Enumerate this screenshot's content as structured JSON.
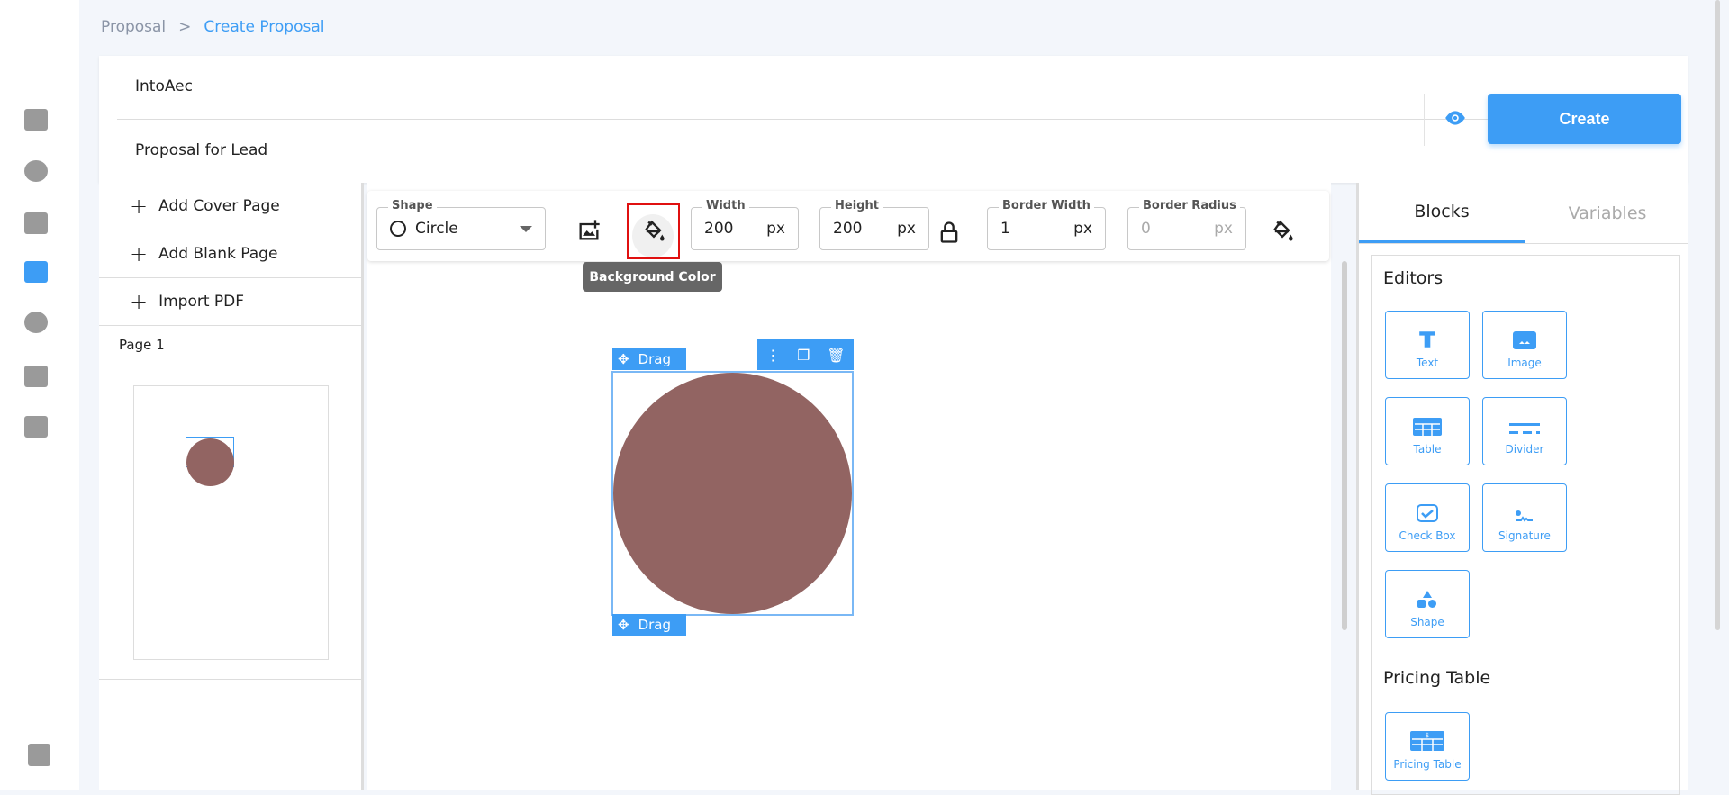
{
  "breadcrumb": {
    "parent": "Proposal",
    "separator": ">",
    "current": "Create Proposal"
  },
  "header": {
    "company": "IntoAec",
    "title": "Proposal for Lead",
    "create_label": "Create"
  },
  "left_panel": {
    "add_cover": "Add Cover Page",
    "add_blank": "Add Blank Page",
    "import_pdf": "Import PDF",
    "page_label": "Page 1"
  },
  "toolbar": {
    "shape_label": "Shape",
    "shape_value": "Circle",
    "width_label": "Width",
    "width_value": "200",
    "height_label": "Height",
    "height_value": "200",
    "border_width_label": "Border Width",
    "border_width_value": "1",
    "border_radius_label": "Border Radius",
    "border_radius_value": "0",
    "unit": "px",
    "tooltip": "Background Color"
  },
  "element": {
    "drag_label": "Drag",
    "fill_color": "#926462"
  },
  "right_panel": {
    "tabs": [
      "Blocks",
      "Variables"
    ],
    "editors_title": "Editors",
    "blocks": [
      "Text",
      "Image",
      "Table",
      "Divider",
      "Check Box",
      "Signature",
      "Shape"
    ],
    "pricing_title": "Pricing Table",
    "pricing_block": "Pricing Table"
  },
  "colors": {
    "accent": "#3d9df5"
  }
}
